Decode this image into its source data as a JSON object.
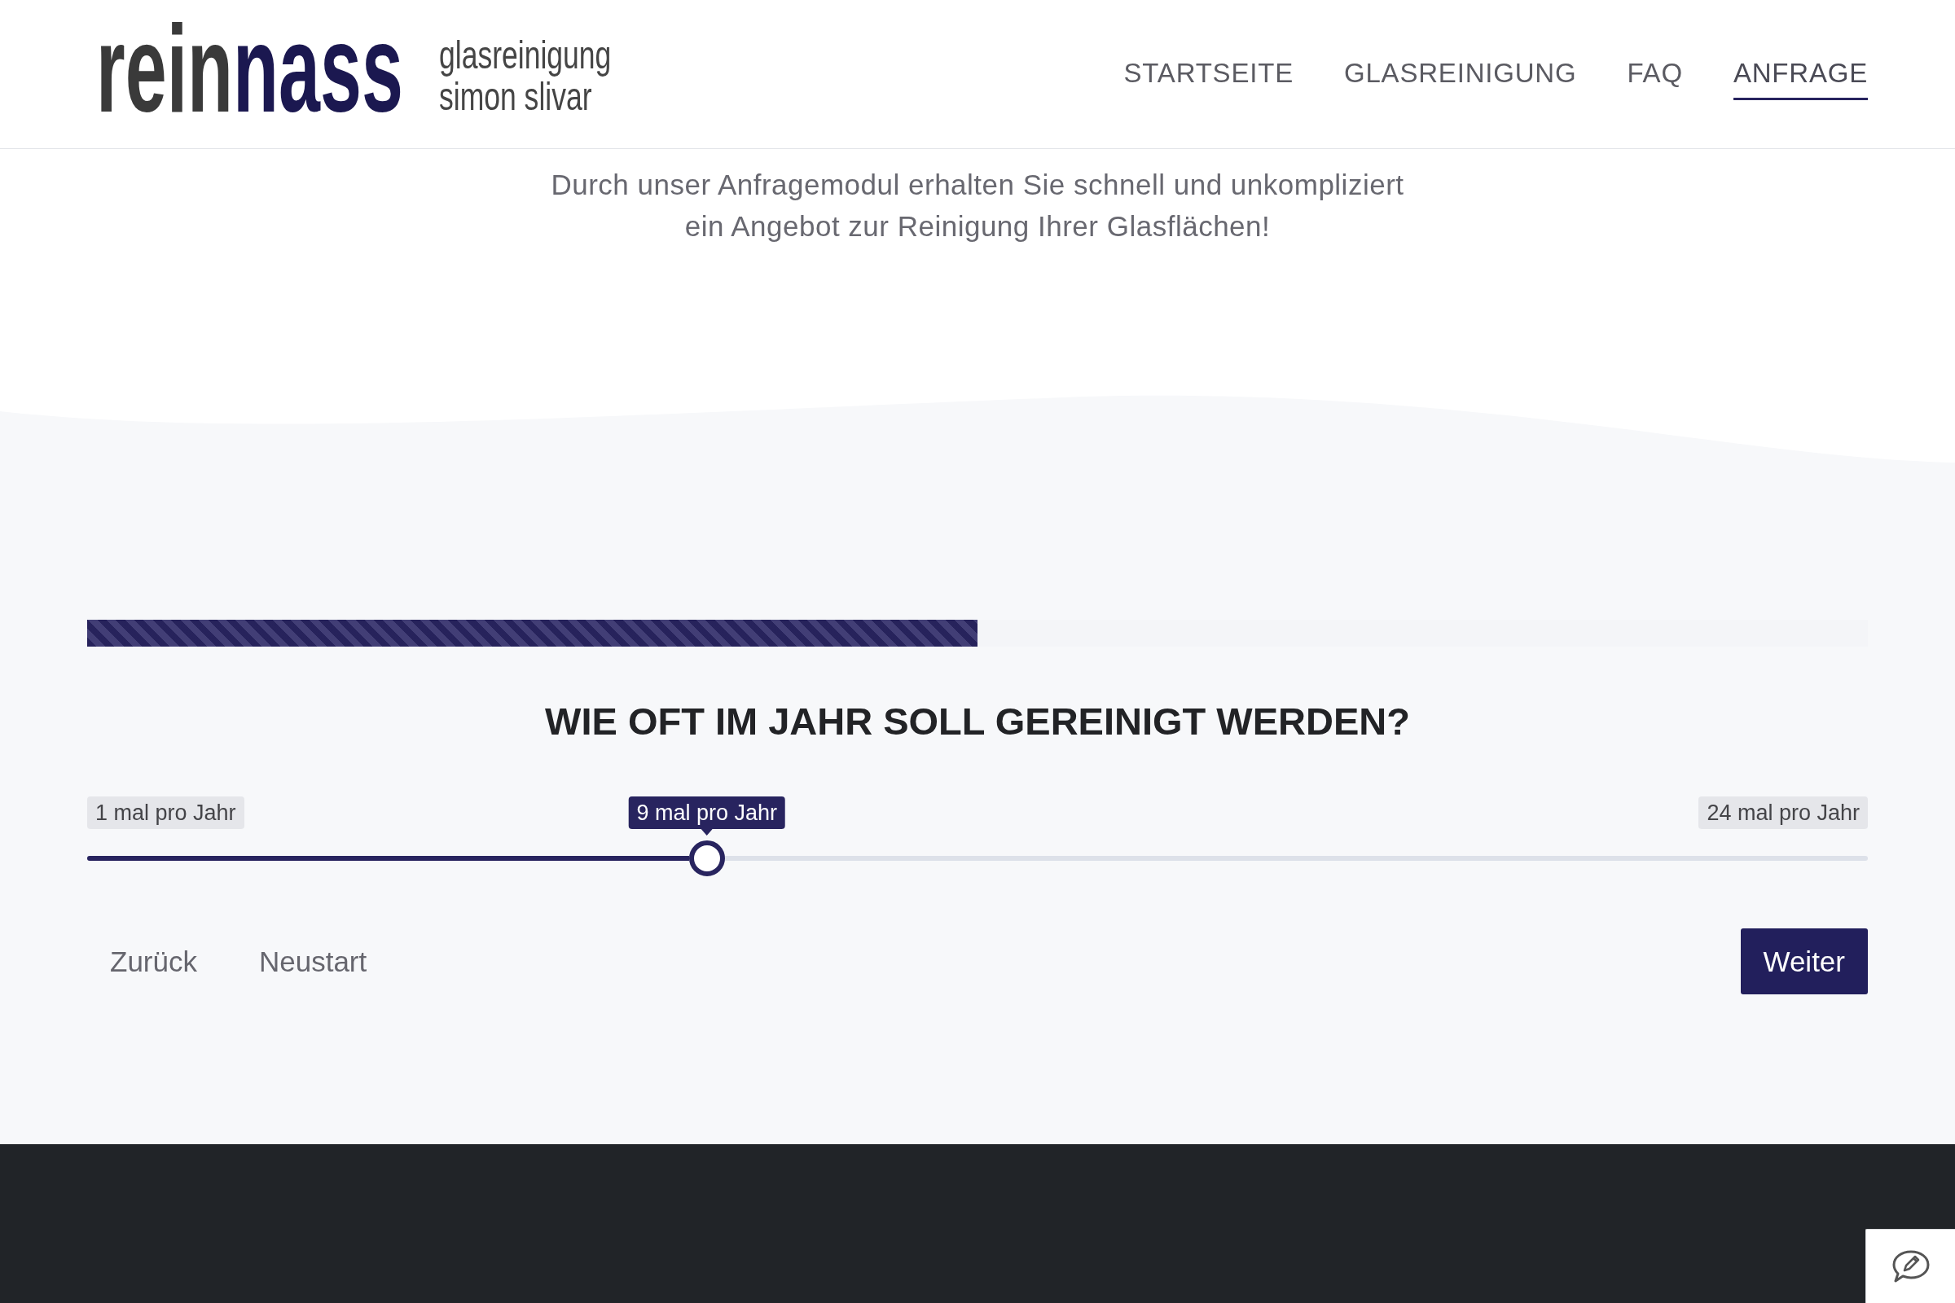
{
  "header": {
    "logo": {
      "wordmark_dark": "rein",
      "wordmark_accent": "nass",
      "tagline": [
        "glasreinigung",
        "simon slivar"
      ]
    },
    "nav": [
      {
        "label": "STARTSEITE",
        "selected": false
      },
      {
        "label": "GLASREINIGUNG",
        "selected": false
      },
      {
        "label": "FAQ",
        "selected": false
      },
      {
        "label": "ANFRAGE",
        "selected": true
      }
    ]
  },
  "intro": "Durch unser Anfragemodul erhalten Sie schnell und unkompliziert ein Angebot zur Reinigung Ihrer Glasflächen!",
  "progress": {
    "level": 0.5
  },
  "question": "WIE OFT IM JAHR SOLL GEREINIGT WERDEN?",
  "slider": {
    "min_label": "1 mal pro Jahr",
    "value_label": "9 mal pro Jahr",
    "max_label": "24 mal pro Jahr",
    "level": 0.348
  },
  "buttons": [
    {
      "label": "Zurück",
      "kind": "text"
    },
    {
      "label": "Neustart",
      "kind": "text"
    },
    {
      "label": "Weiter",
      "kind": "primary"
    }
  ]
}
